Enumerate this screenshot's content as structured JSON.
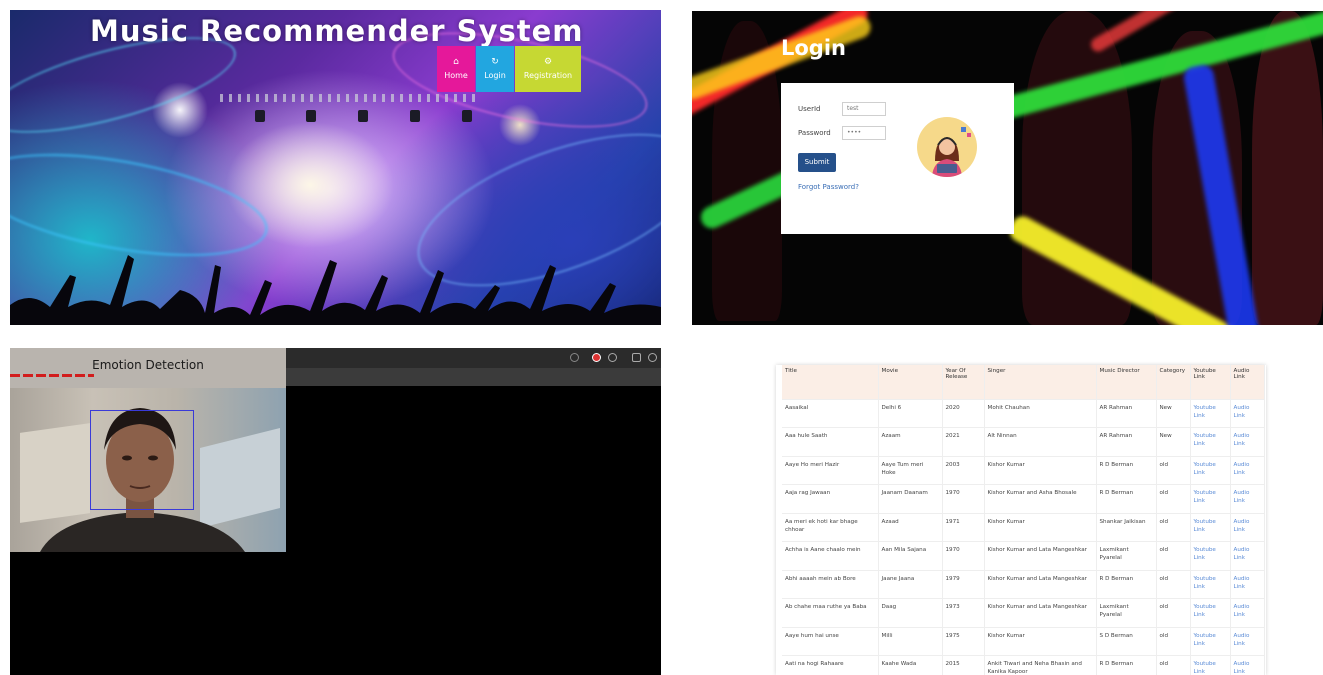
{
  "home": {
    "title": "Music Recommender System",
    "nav": [
      {
        "label": "Home",
        "icon": "house-icon",
        "color": "#e5189a"
      },
      {
        "label": "Login",
        "icon": "login-icon",
        "color": "#22a6e0"
      },
      {
        "label": "Registration",
        "icon": "gear-icon",
        "color": "#c6d833"
      }
    ]
  },
  "login": {
    "title": "Login",
    "userid_label": "UserId",
    "userid_value": "test",
    "password_label": "Password",
    "password_value": "••••",
    "submit_label": "Submit",
    "forgot_label": "Forgot Password?"
  },
  "emotion": {
    "window_title": "Emotion Detection"
  },
  "songs": {
    "columns": [
      "Title",
      "Movie",
      "Year Of Release",
      "Singer",
      "Music Director",
      "Category",
      "Youtube Link",
      "Audio Link"
    ],
    "rows": [
      [
        "Aasaikal",
        "Delhi 6",
        "2020",
        "Mohit Chauhan",
        "AR Rahman",
        "New",
        "Youtube Link",
        "Audio Link"
      ],
      [
        "Aaa hule Saath",
        "Azaam",
        "2021",
        "Alt Ninnan",
        "AR Rahman",
        "New",
        "Youtube Link",
        "Audio Link"
      ],
      [
        "Aaye Ho meri Hazir",
        "Aaye Tum meri Hoke",
        "2003",
        "Kishor Kumar",
        "R D Berman",
        "old",
        "Youtube Link",
        "Audio Link"
      ],
      [
        "Aaja rag Jawaan",
        "Jaanam Daanam",
        "1970",
        "Kishor Kumar and Asha Bhosale",
        "R D Berman",
        "old",
        "Youtube Link",
        "Audio Link"
      ],
      [
        "Aa meri ek hoti kar bhage chhoar",
        "Azaad",
        "1971",
        "Kishor Kumar",
        "Shankar Jaikisan",
        "old",
        "Youtube Link",
        "Audio Link"
      ],
      [
        "Achha is Aane chaalo mein",
        "Aan Mila Sajana",
        "1970",
        "Kishor Kumar and Lata Mangeshkar",
        "Laxmikant Pyarelal",
        "old",
        "Youtube Link",
        "Audio Link"
      ],
      [
        "Abhi aaaah mein ab Bore",
        "Jaane Jaana",
        "1979",
        "Kishor Kumar and Lata Mangeshkar",
        "R D Berman",
        "old",
        "Youtube Link",
        "Audio Link"
      ],
      [
        "Ab chahe maa ruthe ya Baba",
        "Daag",
        "1973",
        "Kishor Kumar and Lata Mangeshkar",
        "Laxmikant Pyarelal",
        "old",
        "Youtube Link",
        "Audio Link"
      ],
      [
        "Aaye hum hai unse",
        "Milli",
        "1975",
        "Kishor Kumar",
        "S D Berman",
        "old",
        "Youtube Link",
        "Audio Link"
      ],
      [
        "Aati na hogi Rahaare",
        "Kaahe Wada",
        "2015",
        "Ankit Tiwari and Neha Bhasin and Kanika Kapoor",
        "R D Berman",
        "old",
        "Youtube Link",
        "Audio Link"
      ]
    ]
  }
}
